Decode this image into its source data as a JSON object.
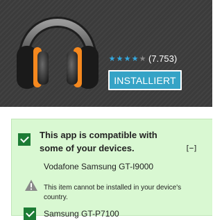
{
  "app": {
    "rating": {
      "stars_filled": 4,
      "stars_total": 5,
      "count": "(7.753)"
    },
    "install_button_label": "INSTALLIERT"
  },
  "compatibility": {
    "title": "This app is compatible with some of your devices.",
    "collapse_label": "[−]",
    "devices": [
      {
        "name": "Vodafone Samsung GT-I9000",
        "status": "incompatible",
        "note": "This item cannot be installed in your device's country."
      },
      {
        "name": "Samsung GT-P7100",
        "status": "compatible"
      }
    ]
  },
  "colors": {
    "header_bg": "#3b3b3b",
    "star_on": "#34a9e0",
    "install_button": "#35a3c6",
    "panel_bg": "#d9f8d2",
    "check_green": "#1d7c35",
    "headphone_accent": "#f5881e"
  },
  "icons": {
    "app_icon": "headphones-icon",
    "check": "checkmark-icon",
    "warning": "warning-triangle-icon"
  }
}
